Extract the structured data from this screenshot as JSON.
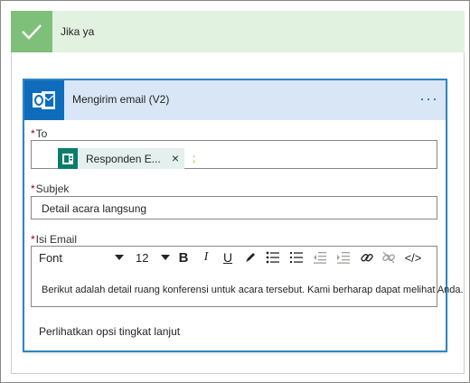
{
  "condition": {
    "title": "Jika ya",
    "color": "#7ec07a",
    "header_bg": "#e2f2e0"
  },
  "action": {
    "title": "Mengirim email (V2)",
    "icon": "outlook-icon",
    "more_label": "···",
    "accent": "#0f6cbd"
  },
  "fields": {
    "to": {
      "required_mark": "*",
      "label": "To",
      "token": {
        "label": "Responden E...",
        "icon": "forms-icon",
        "remove": "×"
      },
      "separator": ";"
    },
    "subject": {
      "required_mark": "*",
      "label": "Subjek",
      "value": "Detail acara langsung"
    },
    "body": {
      "required_mark": "*",
      "label": "Isi Email",
      "toolbar": {
        "font": "Font",
        "size": "12",
        "bold": "B",
        "italic": "I",
        "underline": "U",
        "code": "</>"
      },
      "value": "Berikut adalah detail ruang konferensi untuk acara tersebut. Kami berharap dapat melihat Anda."
    }
  },
  "advanced_link": "Perlihatkan opsi tingkat lanjut"
}
